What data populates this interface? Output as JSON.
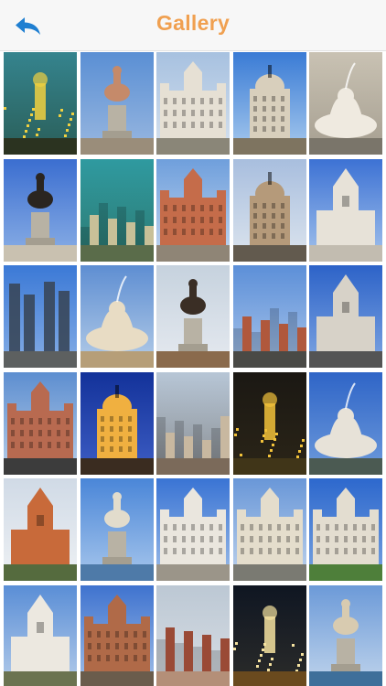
{
  "header": {
    "title": "Gallery",
    "back_icon": "back-arrow-icon"
  },
  "colors": {
    "accent": "#f0a050",
    "back": "#1f7fd1"
  },
  "gallery": {
    "columns": 5,
    "photos": [
      {
        "name": "photo-night-skyline",
        "sky": [
          "#35848e",
          "#2a5e58"
        ],
        "ground": "#2b3320",
        "glow": "#f0d040",
        "kind": "night"
      },
      {
        "name": "photo-bear-statue",
        "sky": [
          "#5a8fd4",
          "#9ab8e0"
        ],
        "ground": "#9a8d7a",
        "glow": "#c58a6a",
        "kind": "statue"
      },
      {
        "name": "photo-cibeles-palace",
        "sky": [
          "#a7c1e0",
          "#d7e2ee"
        ],
        "ground": "#8a8678",
        "glow": "#e6e0d4",
        "kind": "palace"
      },
      {
        "name": "photo-metropolis-building",
        "sky": [
          "#3a7bd5",
          "#a9cbee"
        ],
        "ground": "#7e7460",
        "glow": "#d8cfbc",
        "kind": "tower"
      },
      {
        "name": "photo-fountain-sculpture",
        "sky": [
          "#c9c2b3",
          "#a59e90"
        ],
        "ground": "#7a756a",
        "glow": "#efeae0",
        "kind": "fountain"
      },
      {
        "name": "photo-equestrian-statue",
        "sky": [
          "#3b6ed0",
          "#8db1e6"
        ],
        "ground": "#c9c1b0",
        "glow": "#2a2520",
        "kind": "statue"
      },
      {
        "name": "photo-rooftops-teal",
        "sky": [
          "#2f9aa0",
          "#2e7a72"
        ],
        "ground": "#5a6c4a",
        "glow": "#c8c098",
        "kind": "city"
      },
      {
        "name": "photo-plaza-mayor",
        "sky": [
          "#6f9fdc",
          "#c4d7ee"
        ],
        "ground": "#8f8576",
        "glow": "#c56c4a",
        "kind": "palace"
      },
      {
        "name": "photo-street-corner",
        "sky": [
          "#a8bede",
          "#dde5ee"
        ],
        "ground": "#625a4e",
        "glow": "#b59a7a",
        "kind": "tower"
      },
      {
        "name": "photo-cathedral-lamp",
        "sky": [
          "#3d72d4",
          "#a4c3ec"
        ],
        "ground": "#c2bcb0",
        "glow": "#e7e2d8",
        "kind": "church"
      },
      {
        "name": "photo-four-towers",
        "sky": [
          "#3b79d6",
          "#86aee6"
        ],
        "ground": "#5d6060",
        "glow": "#39475a",
        "kind": "skyscraper"
      },
      {
        "name": "photo-lion-fountain",
        "sky": [
          "#5e8ed2",
          "#b5cde8"
        ],
        "ground": "#b69e78",
        "glow": "#e8dcc4",
        "kind": "fountain"
      },
      {
        "name": "photo-monument-tower",
        "sky": [
          "#c6d2de",
          "#e6eaf0"
        ],
        "ground": "#8a6a4c",
        "glow": "#3a2e25",
        "kind": "statue"
      },
      {
        "name": "photo-brick-building",
        "sky": [
          "#5c8fd8",
          "#a9c5ea"
        ],
        "ground": "#4a4a46",
        "glow": "#b0583c",
        "kind": "city"
      },
      {
        "name": "photo-almudena",
        "sky": [
          "#2d63c8",
          "#7fa6e2"
        ],
        "ground": "#545454",
        "glow": "#d7d2c8",
        "kind": "church"
      },
      {
        "name": "photo-bullring",
        "sky": [
          "#5d8ed0",
          "#b9cfe8"
        ],
        "ground": "#3c3c3c",
        "glow": "#b86a50",
        "kind": "palace"
      },
      {
        "name": "photo-metropolis-dusk",
        "sky": [
          "#13329a",
          "#3e5ec4"
        ],
        "ground": "#3a2c20",
        "glow": "#f0b040",
        "kind": "tower"
      },
      {
        "name": "photo-city-overview",
        "sky": [
          "#b7c6d6",
          "#8a8e92"
        ],
        "ground": "#7b6a5a",
        "glow": "#c8b8a0",
        "kind": "city"
      },
      {
        "name": "photo-night-lights",
        "sky": [
          "#1b1813",
          "#2b2518"
        ],
        "ground": "#403518",
        "glow": "#f2c23a",
        "kind": "night"
      },
      {
        "name": "photo-cibeles-fountain",
        "sky": [
          "#2f65c7",
          "#6e9bdc"
        ],
        "ground": "#4b5a52",
        "glow": "#e7e2d8",
        "kind": "fountain"
      },
      {
        "name": "photo-clock-tower",
        "sky": [
          "#d0dae6",
          "#eef1f4"
        ],
        "ground": "#556b3e",
        "glow": "#c86a3a",
        "kind": "church"
      },
      {
        "name": "photo-retiro-pond",
        "sky": [
          "#4a86d8",
          "#a8c7ec"
        ],
        "ground": "#4e7aa8",
        "glow": "#e2dccc",
        "kind": "statue"
      },
      {
        "name": "photo-palace-white",
        "sky": [
          "#3a74d4",
          "#9ebee8"
        ],
        "ground": "#9b9589",
        "glow": "#eae6de",
        "kind": "palace"
      },
      {
        "name": "photo-royal-palace",
        "sky": [
          "#6997d8",
          "#bfd3ec"
        ],
        "ground": "#7a7a72",
        "glow": "#e4ddcc",
        "kind": "palace"
      },
      {
        "name": "photo-palace-garden",
        "sky": [
          "#2d68cd",
          "#78a3e0"
        ],
        "ground": "#4e7f3a",
        "glow": "#e3ddd0",
        "kind": "palace"
      },
      {
        "name": "photo-palace-front",
        "sky": [
          "#5a8ed6",
          "#b6cdea"
        ],
        "ground": "#6b7350",
        "glow": "#ece8e0",
        "kind": "church"
      },
      {
        "name": "photo-las-ventas",
        "sky": [
          "#3f73cf",
          "#a3c0e8"
        ],
        "ground": "#6a5c4c",
        "glow": "#b06a48",
        "kind": "palace"
      },
      {
        "name": "photo-plaza-crowd",
        "sky": [
          "#bcc8d4",
          "#d9dee4"
        ],
        "ground": "#b48f78",
        "glow": "#9a4a36",
        "kind": "city"
      },
      {
        "name": "photo-kio-towers",
        "sky": [
          "#0f1622",
          "#2c2c2a"
        ],
        "ground": "#6a4a1e",
        "glow": "#f5e2a0",
        "kind": "night"
      },
      {
        "name": "photo-retiro-monument",
        "sky": [
          "#6c9ad8",
          "#c1d5ec"
        ],
        "ground": "#3e6f9a",
        "glow": "#d8cbb0",
        "kind": "statue"
      }
    ]
  }
}
